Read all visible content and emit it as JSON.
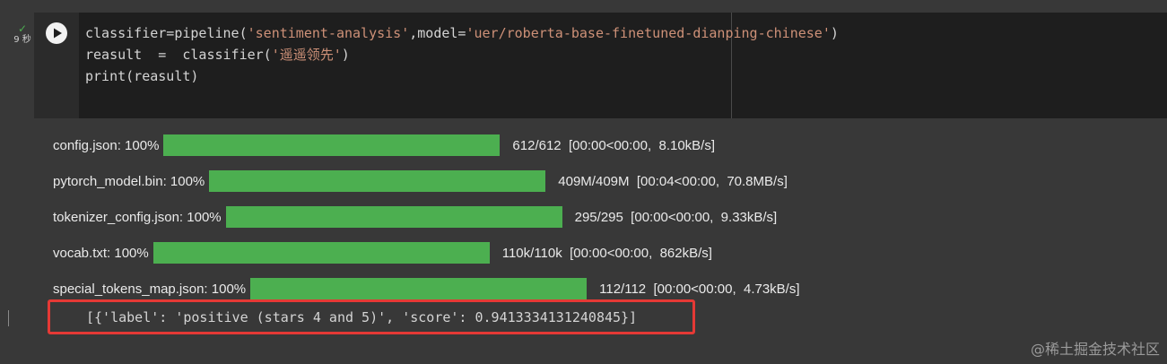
{
  "cell": {
    "status_icon": "check-icon",
    "status_text": "9 秒",
    "run_icon": "play-icon"
  },
  "code": {
    "line1_prefix": "classifier=pipeline(",
    "line1_str1": "'sentiment-analysis'",
    "line1_mid": ",model=",
    "line1_str2": "'uer/roberta-base-finetuned-dianping-chinese'",
    "line1_suffix": ")",
    "line2_prefix": "reasult  =  classifier(",
    "line2_str": "'遥遥领先'",
    "line2_suffix": ")",
    "line3": "print(reasult)"
  },
  "downloads": [
    {
      "label": "config.json: 100%",
      "stats": "612/612  [00:00<00:00,  8.10kB/s]",
      "progress": 1.0
    },
    {
      "label": "pytorch_model.bin: 100%",
      "stats": "409M/409M  [00:04<00:00,  70.8MB/s]",
      "progress": 1.0
    },
    {
      "label": "tokenizer_config.json: 100%",
      "stats": "295/295  [00:00<00:00,  9.33kB/s]",
      "progress": 1.0
    },
    {
      "label": "vocab.txt: 100%",
      "stats": "110k/110k  [00:00<00:00,  862kB/s]",
      "progress": 1.0
    },
    {
      "label": "special_tokens_map.json: 100%",
      "stats": "112/112  [00:00<00:00,  4.73kB/s]",
      "progress": 1.0
    }
  ],
  "result": {
    "text": "[{'label': 'positive (stars 4 and 5)', 'score': 0.9413334131240845}]"
  },
  "watermark": "@稀土掘金技术社区",
  "colors": {
    "progress_fill": "#4caf50",
    "highlight_border": "#e53935",
    "string": "#ce9178"
  }
}
